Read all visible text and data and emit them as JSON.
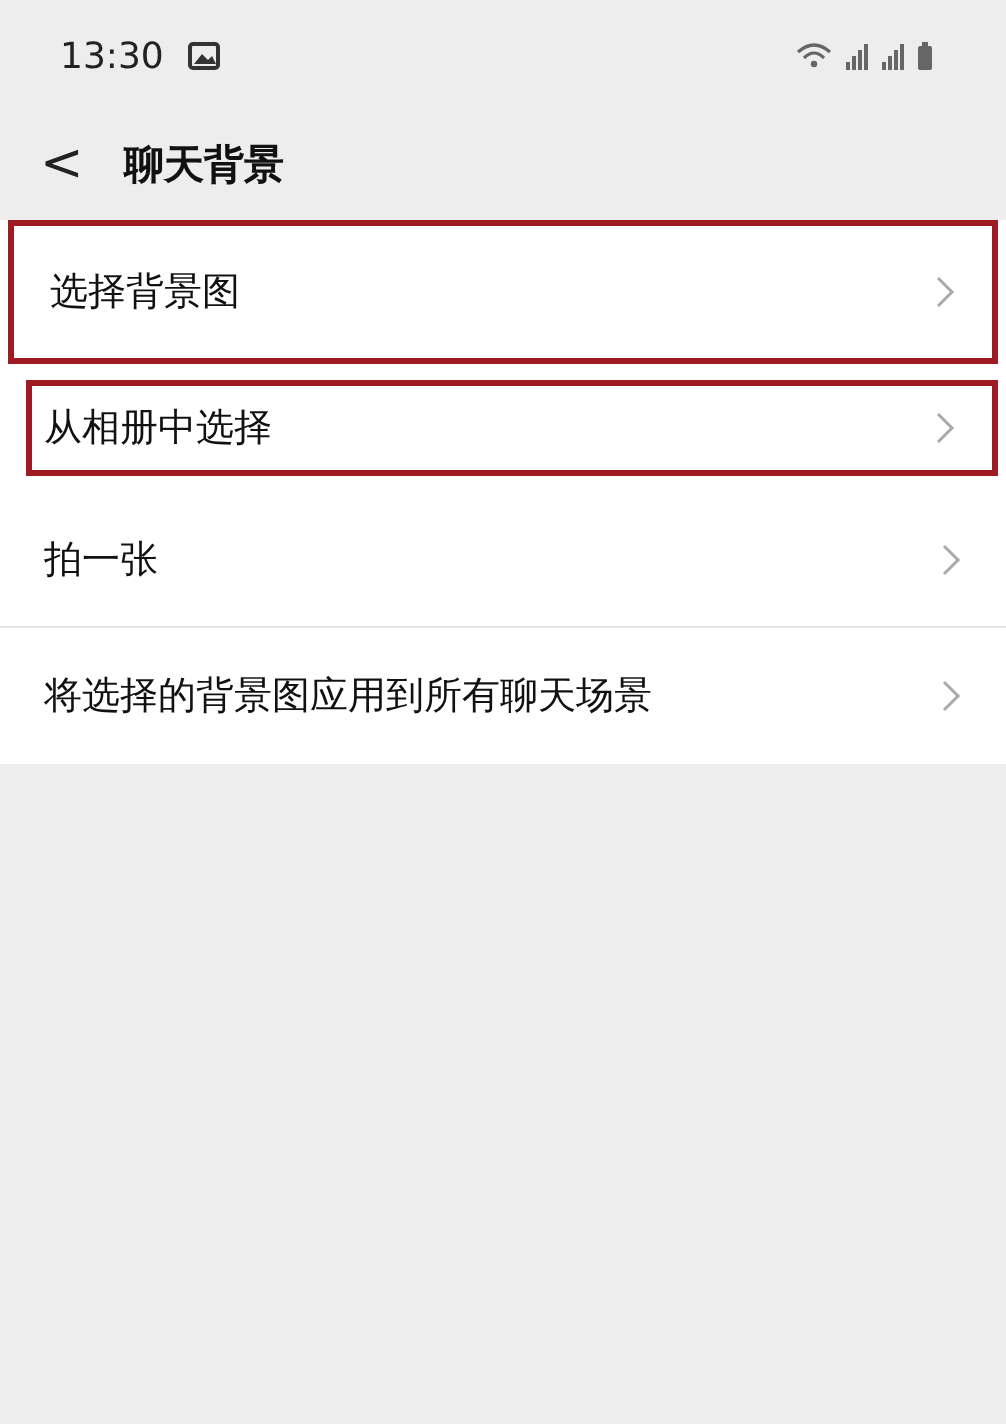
{
  "status_bar": {
    "time": "13:30"
  },
  "header": {
    "back": "<",
    "title": "聊天背景"
  },
  "items": [
    {
      "label": "选择背景图",
      "highlighted": true
    },
    {
      "label": "从相册中选择",
      "highlighted": true
    },
    {
      "label": "拍一张",
      "highlighted": false
    },
    {
      "label": "将选择的背景图应用到所有聊天场景",
      "highlighted": false
    }
  ]
}
